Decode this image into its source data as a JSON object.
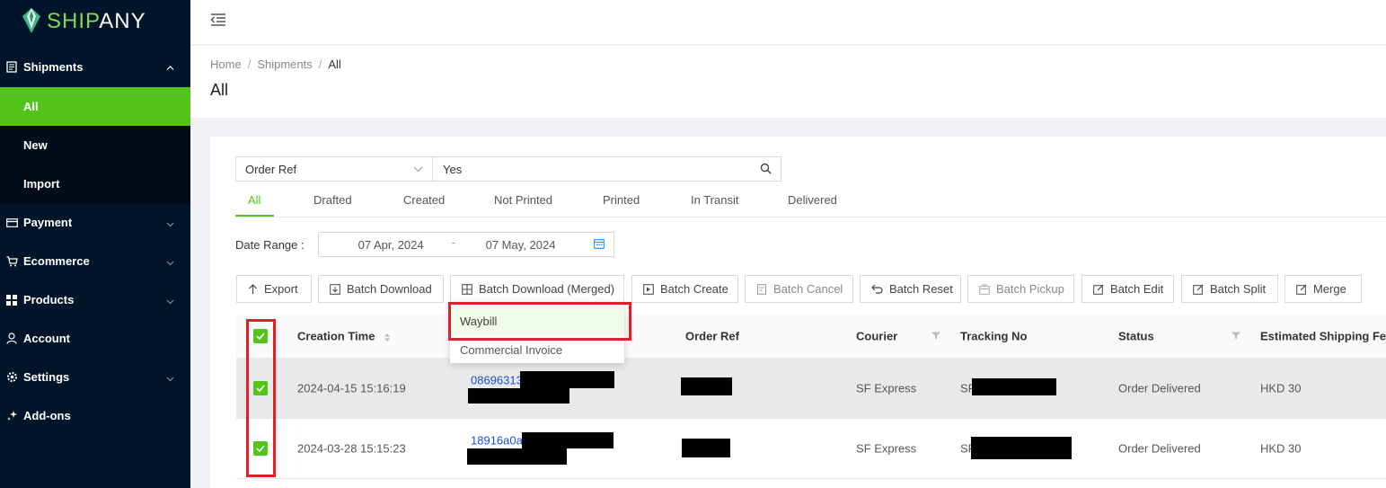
{
  "brand": {
    "part1": "SHIP",
    "part2": "ANY"
  },
  "sidebar": {
    "shipments": "Shipments",
    "sub": [
      {
        "label": "All",
        "active": true
      },
      {
        "label": "New",
        "active": false
      },
      {
        "label": "Import",
        "active": false
      }
    ],
    "items": [
      {
        "label": "Payment",
        "icon": "card-icon"
      },
      {
        "label": "Ecommerce",
        "icon": "cart-icon"
      },
      {
        "label": "Products",
        "icon": "grid-icon"
      },
      {
        "label": "Account",
        "icon": "user-icon"
      },
      {
        "label": "Settings",
        "icon": "gear-icon"
      },
      {
        "label": "Add-ons",
        "icon": "sparkle-icon"
      }
    ]
  },
  "breadcrumb": {
    "home": "Home",
    "shipments": "Shipments",
    "current": "All",
    "sep": "/"
  },
  "page_title": "All",
  "filter": {
    "field": "Order Ref",
    "value": "Yes"
  },
  "tabs": [
    "All",
    "Drafted",
    "Created",
    "Not Printed",
    "Printed",
    "In Transit",
    "Delivered"
  ],
  "date_range": {
    "label": "Date Range :",
    "start": "07 Apr, 2024",
    "end": "07 May, 2024",
    "sep": "-"
  },
  "buttons": {
    "export": "Export",
    "batch_download": "Batch Download",
    "batch_download_merged": "Batch Download (Merged)",
    "batch_create": "Batch Create",
    "batch_cancel": "Batch Cancel",
    "batch_reset": "Batch Reset",
    "batch_pickup": "Batch Pickup",
    "batch_edit": "Batch Edit",
    "batch_split": "Batch Split",
    "merge": "Merge"
  },
  "dropdown": {
    "waybill": "Waybill",
    "commercial_invoice": "Commercial Invoice"
  },
  "table": {
    "headers": {
      "creation_time": "Creation Time",
      "order_ref": "Order Ref",
      "courier": "Courier",
      "tracking_no": "Tracking No",
      "status": "Status",
      "fee": "Estimated Shipping Fee"
    },
    "rows": [
      {
        "time": "2024-04-15 15:16:19",
        "id": "08696313",
        "courier": "SF Express",
        "tracking": "SF",
        "status": "Order Delivered",
        "fee": "HKD 30"
      },
      {
        "time": "2024-03-28 15:15:23",
        "id": "18916a0a-",
        "courier": "SF Express",
        "tracking": "SF",
        "status": "Order Delivered",
        "fee": "HKD 30"
      }
    ]
  },
  "colors": {
    "accent": "#52c41a",
    "sidebar_bg": "#001529",
    "annotation": "#e0202a",
    "link": "#1a4fd6"
  }
}
